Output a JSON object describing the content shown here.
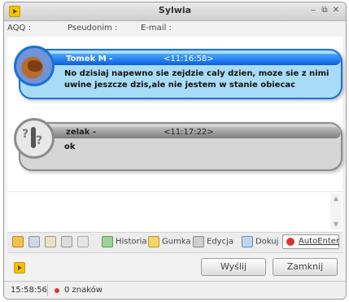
{
  "window": {
    "title": "Sylwia"
  },
  "info": {
    "aqq": "AQQ :",
    "nick": "Pseudonim :",
    "email": "E-mail :"
  },
  "messages": [
    {
      "name": "Tomek M -",
      "time": "<11:16:58>",
      "text": "No dzisiaj napewno sie zejdzie caly dzien, moze sie z nimi uwine jeszcze dzis,ale nie jestem w stanie obiecac"
    },
    {
      "name": "zelak -",
      "time": "<11:17:22>",
      "text": "ok"
    }
  ],
  "toolbar": {
    "history": "Historia",
    "eraser": "Gumka",
    "edit": "Edycja",
    "dock": "Dokuj",
    "auto_enter": "AutoEnter"
  },
  "actions": {
    "send": "Wyślij",
    "close": "Zamknij"
  },
  "status": {
    "time": "15:58:56",
    "chars": "0 znaków"
  },
  "colors": {
    "outgoing_bg": "#a8dcf6",
    "outgoing_border": "#1d6fd6",
    "incoming_bg": "#d6d6d6"
  }
}
